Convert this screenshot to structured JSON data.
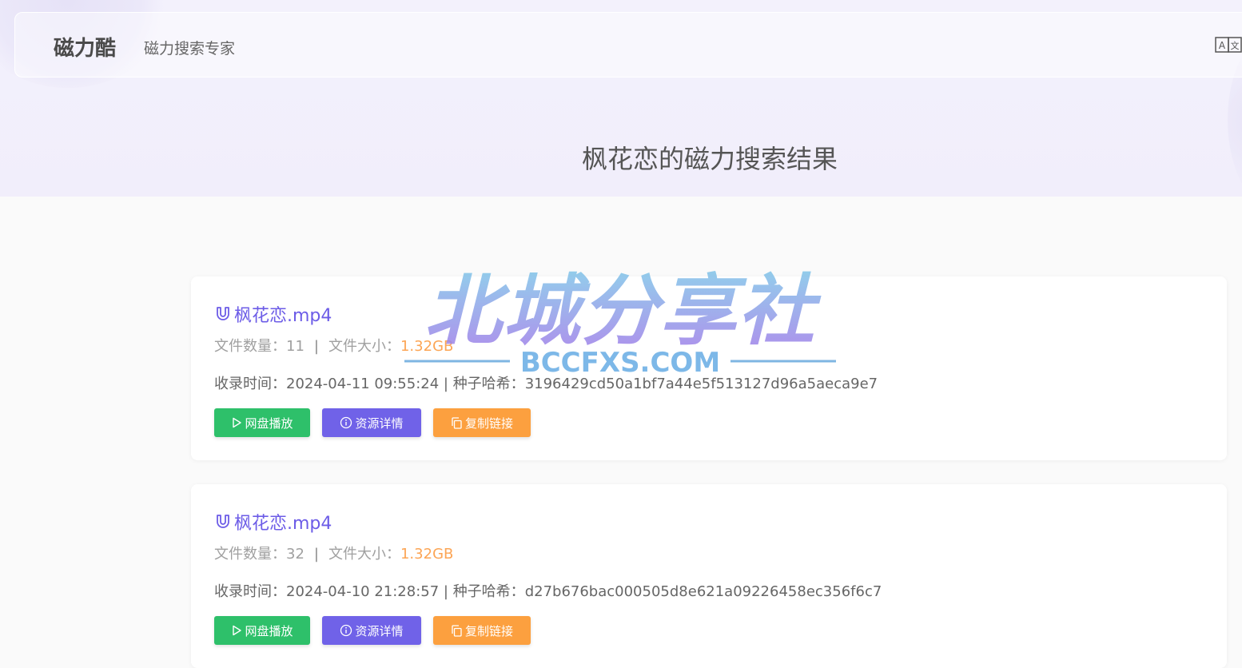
{
  "header": {
    "logo": "磁力酷",
    "tagline": "磁力搜索专家",
    "language_icon": "translate-icon"
  },
  "page_title": "枫花恋的磁力搜索结果",
  "labels": {
    "file_count": "文件数量：",
    "file_size": "文件大小：",
    "separator": "|",
    "indexed_time": "收录时间：",
    "torrent_hash": "种子哈希：",
    "info_separator": " | "
  },
  "results": [
    {
      "title": "枫花恋.mp4",
      "file_count": "11",
      "file_size": "1.32GB",
      "indexed_time": "2024-04-11 09:55:24",
      "hash": "3196429cd50a1bf7a44e5f513127d96a5aeca9e7",
      "buttons": {
        "play": "网盘播放",
        "detail": "资源详情",
        "copy": "复制链接"
      }
    },
    {
      "title": "枫花恋.mp4",
      "file_count": "32",
      "file_size": "1.32GB",
      "indexed_time": "2024-04-10 21:28:57",
      "hash": "d27b676bac000505d8e621a09226458ec356f6c7",
      "buttons": {
        "play": "网盘播放",
        "detail": "资源详情",
        "copy": "复制链接"
      }
    }
  ],
  "watermark": {
    "main": "北城分享社",
    "sub": "BCCFXS.COM"
  },
  "colors": {
    "accent": "#6c5ce7",
    "play": "#2ec06a",
    "detail": "#7062e8",
    "copy": "#fca03f",
    "size": "#fca555"
  }
}
